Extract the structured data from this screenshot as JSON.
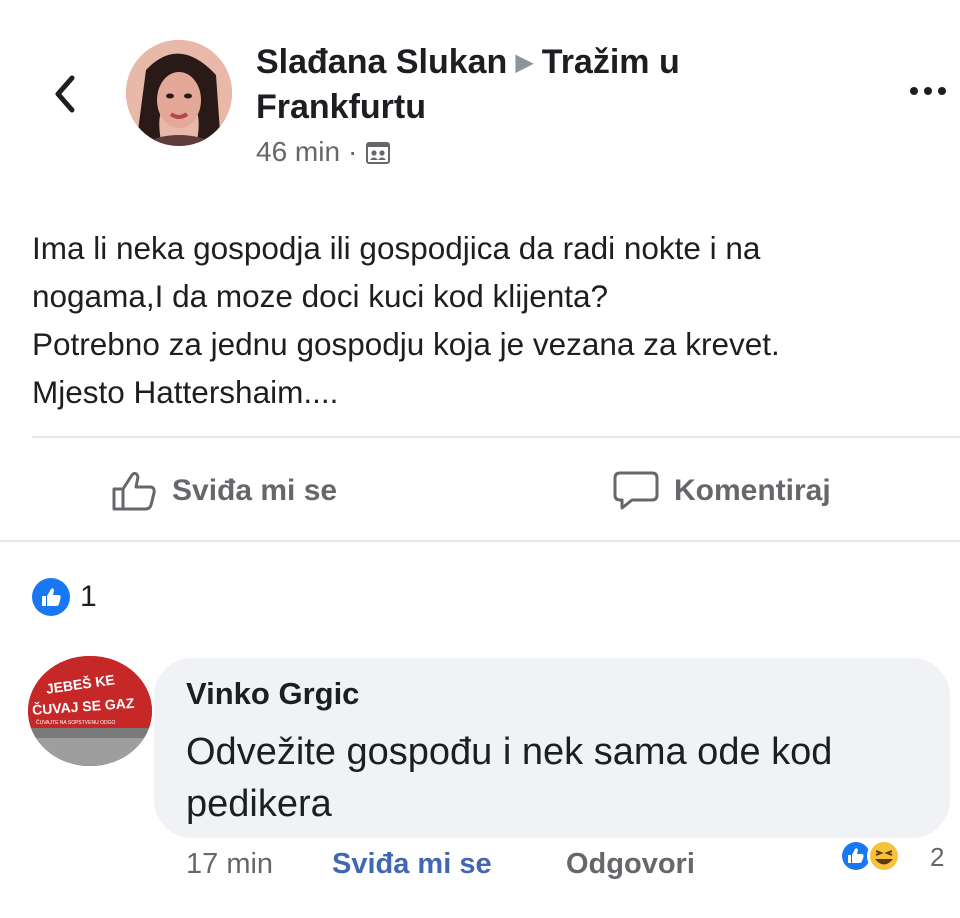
{
  "post": {
    "author": "Slađana Slukan",
    "group": "Tražim u",
    "group_line2": "Frankfurtu",
    "time": "46 min",
    "privacy_icon": "group-audience-icon",
    "text_lines": [
      "Ima li neka gospodja ili gospodjica da radi  nokte i na",
      "nogama,I da moze doci kuci kod klijenta?",
      "Potrebno za jednu gospodju koja je vezana za krevet.",
      "Mjesto Hattershaim...."
    ]
  },
  "actions": {
    "like_label": "Sviđa mi se",
    "comment_label": "Komentiraj"
  },
  "reactions": {
    "count": "1"
  },
  "comment": {
    "author": "Vinko Grgic",
    "text_lines": [
      "Odvežite gospođu i nek sama ode kod",
      "pedikera"
    ],
    "time": "17 min",
    "like_label": "Sviđa mi se",
    "reply_label": "Odgovori",
    "reaction_count": "2",
    "avatar_text": [
      "JEBEŠ KE",
      "ČUVAJ SE GAZ",
      "ČUVAJTE NA SOPSTVENU ODGO"
    ]
  },
  "colors": {
    "accent": "#1877f2",
    "link": "#4267b2",
    "muted": "#65676b",
    "bubble": "#f0f2f5"
  }
}
